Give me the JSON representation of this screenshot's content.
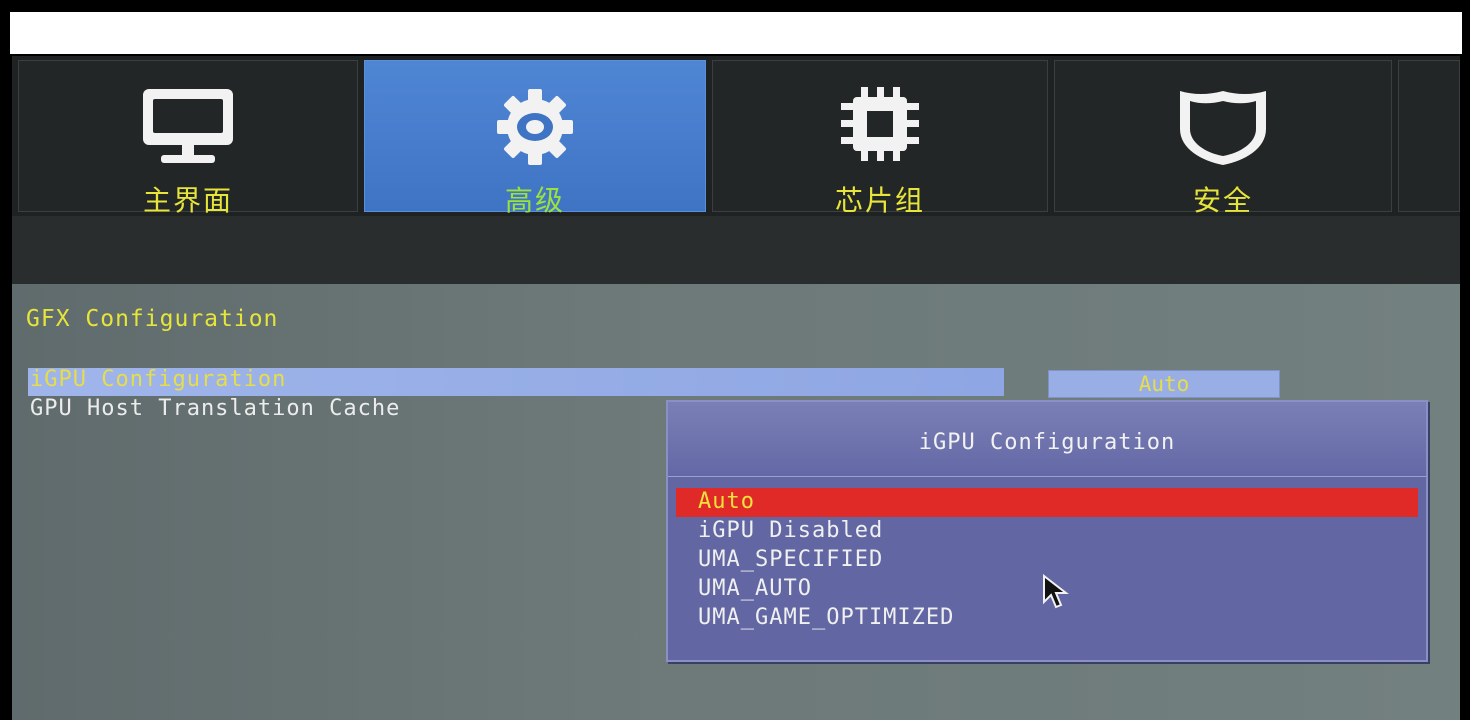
{
  "tabs": [
    {
      "label": "主界面",
      "icon": "monitor-icon",
      "active": false
    },
    {
      "label": "高级",
      "icon": "gear-icon",
      "active": true
    },
    {
      "label": "芯片组",
      "icon": "chip-icon",
      "active": false
    },
    {
      "label": "安全",
      "icon": "shield-icon",
      "active": false
    }
  ],
  "content": {
    "section_title": "GFX Configuration",
    "items": [
      {
        "label": "iGPU Configuration",
        "value": "Auto"
      },
      {
        "label": "GPU Host Translation Cache",
        "value": ""
      }
    ]
  },
  "popup": {
    "title": "iGPU Configuration",
    "options": [
      "Auto",
      "iGPU Disabled",
      "UMA_SPECIFIED",
      "UMA_AUTO",
      "UMA_GAME_OPTIMIZED"
    ],
    "selected_index": 0
  },
  "colors": {
    "active_tab": "#4f86d4",
    "selected_option": "#e02a28",
    "label_yellow": "#e6e53a"
  }
}
